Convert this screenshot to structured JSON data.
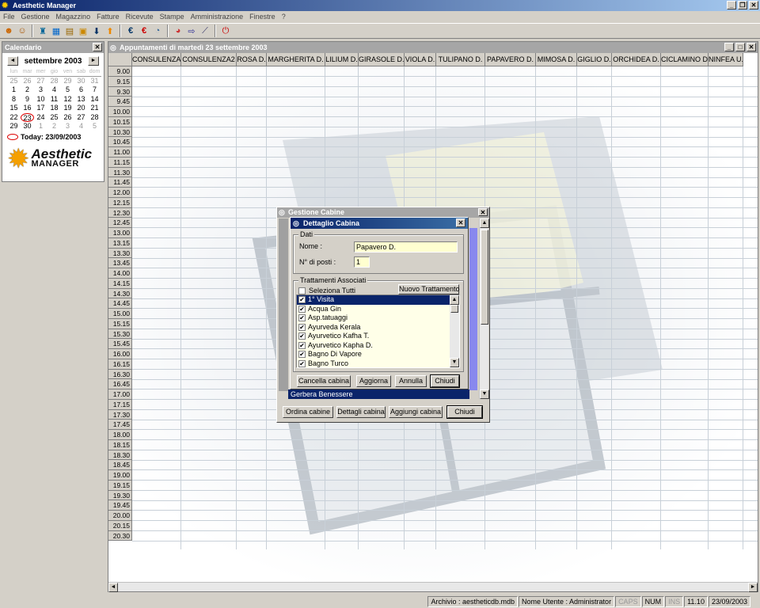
{
  "window": {
    "title": "Aesthetic Manager"
  },
  "menu": [
    "File",
    "Gestione",
    "Magazzino",
    "Fatture",
    "Ricevute",
    "Stampe",
    "Amministrazione",
    "Finestre",
    "?"
  ],
  "toolbar_icons": [
    "user-icon",
    "users-icon",
    "bottle-icon",
    "grid-icon",
    "list-icon",
    "box-icon",
    "arrow-down-icon",
    "arrow-up-icon",
    "euro-icon",
    "euro-red-icon",
    "clock-icon",
    "chart-pie-icon",
    "import-icon",
    "chart-line-icon",
    "exit-icon"
  ],
  "calendar": {
    "panel_title": "Calendario",
    "month": "settembre 2003",
    "prev": "◄",
    "next": "►",
    "dow": [
      "lun",
      "mar",
      "mer",
      "gio",
      "ven",
      "sab",
      "dom"
    ],
    "weeks": [
      [
        "25",
        "26",
        "27",
        "28",
        "29",
        "30",
        "31"
      ],
      [
        "1",
        "2",
        "3",
        "4",
        "5",
        "6",
        "7"
      ],
      [
        "8",
        "9",
        "10",
        "11",
        "12",
        "13",
        "14"
      ],
      [
        "15",
        "16",
        "17",
        "18",
        "19",
        "20",
        "21"
      ],
      [
        "22",
        "23",
        "24",
        "25",
        "26",
        "27",
        "28"
      ],
      [
        "29",
        "30",
        "1",
        "2",
        "3",
        "4",
        "5"
      ]
    ],
    "today_label": "Today: 23/09/2003",
    "logo_line1": "Aesthetic",
    "logo_line2": "MANAGER"
  },
  "appointments": {
    "title": "Appuntamenti di martedì 23 settembre 2003",
    "columns": [
      "CONSULENZA",
      "CONSULENZA2",
      "ROSA D.",
      "MARGHERITA D.",
      "LILIUM D.",
      "GIRASOLE D.",
      "VIOLA D.",
      "TULIPANO D.",
      "PAPAVERO D.",
      "MIMOSA D.",
      "GIGLIO D.",
      "ORCHIDEA D.",
      "CICLAMINO D.",
      "NINFEA U."
    ],
    "times": [
      "9.00",
      "9.15",
      "9.30",
      "9.45",
      "10.00",
      "10.15",
      "10.30",
      "10.45",
      "11.00",
      "11.15",
      "11.30",
      "11.45",
      "12.00",
      "12.15",
      "12.30",
      "12.45",
      "13.00",
      "13.15",
      "13.30",
      "13.45",
      "14.00",
      "14.15",
      "14.30",
      "14.45",
      "15.00",
      "15.15",
      "15.30",
      "15.45",
      "16.00",
      "16.15",
      "16.30",
      "16.45",
      "17.00",
      "17.15",
      "17.30",
      "17.45",
      "18.00",
      "18.15",
      "18.30",
      "18.45",
      "19.00",
      "19.15",
      "19.30",
      "19.45",
      "20.00",
      "20.15",
      "20.30"
    ]
  },
  "gestione_cabine": {
    "title": "Gestione Cabine",
    "list_bottom_item": "Gerbera Benessere",
    "buttons": {
      "ordina": "Ordina cabine",
      "dettagli": "Dettagli cabina",
      "aggiungi": "Aggiungi cabina",
      "chiudi": "Chiudi"
    }
  },
  "dettaglio_cabina": {
    "title": "Dettaglio Cabina",
    "group_dati": "Dati",
    "nome_label": "Nome :",
    "nome_value": "Papavero D.",
    "posti_label": "N° di posti :",
    "posti_value": "1",
    "group_trattamenti": "Trattamenti Associati",
    "seleziona_tutti": "Seleziona Tutti",
    "nuovo_trattamento": "Nuovo Trattamento",
    "trattamenti": [
      "1° Visita",
      "Acqua Gin",
      "Asp.tatuaggi",
      "Ayurveda Kerala",
      "Ayurvetico Kafha T.",
      "Ayurvetico Kapha D.",
      "Bagno Di Vapore",
      "Bagno Turco"
    ],
    "buttons": {
      "cancella": "Cancella cabina",
      "aggiorna": "Aggiorna",
      "annulla": "Annulla",
      "chiudi": "Chiudi"
    }
  },
  "status": {
    "archivio": "Archivio : aestheticdb.mdb",
    "utente": "Nome Utente : Administrator",
    "caps": "CAPS",
    "num": "NUM",
    "ins": "INS",
    "time": "11.10",
    "date": "23/09/2003"
  },
  "colors": {
    "accent": "#0a246a",
    "field_bg": "#ffffd0",
    "today_circle": "#dd0000"
  }
}
